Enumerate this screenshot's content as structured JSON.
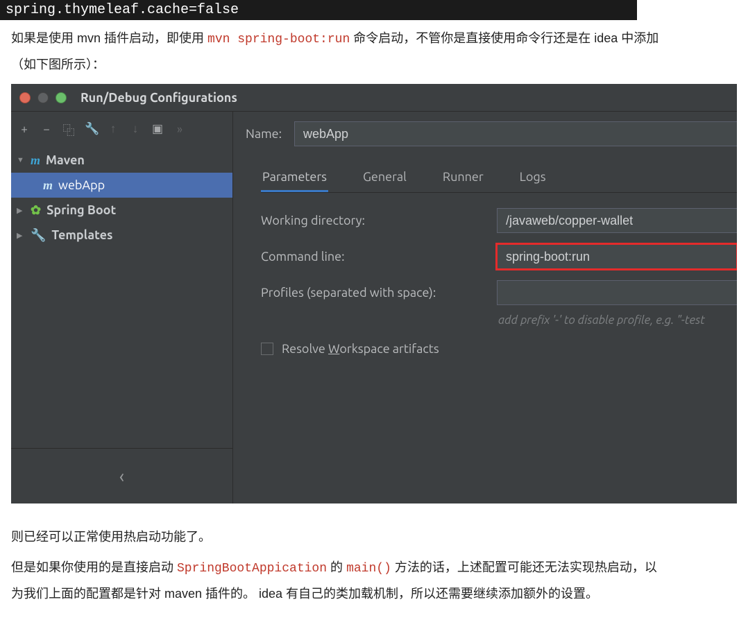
{
  "banner": "spring.thymeleaf.cache=false",
  "para1_a": "如果是使用 mvn 插件启动，即使用 ",
  "para1_code": "mvn spring-boot:run",
  "para1_b": " 命令启动，不管你是直接使用命令行还是在 idea 中添加（如下图所示）：",
  "ide": {
    "title": "Run/Debug Configurations",
    "toolbar": {
      "add": "+",
      "remove": "−",
      "copy": "⿻",
      "wrench": "🔧",
      "up": "↑",
      "down": "↓",
      "folder": "▣",
      "more": "»"
    },
    "tree": {
      "maven": {
        "label": "Maven",
        "child": "webApp"
      },
      "springboot": "Spring Boot",
      "templates": "Templates"
    },
    "nameLabel": "Name:",
    "nameValue": "webApp",
    "tabs": {
      "parameters": "Parameters",
      "general": "General",
      "runner": "Runner",
      "logs": "Logs"
    },
    "form": {
      "wdLabel": "Working directory:",
      "wdValue": "/javaweb/copper-wallet",
      "clLabel": "Command line:",
      "clValue": "spring-boot:run",
      "profLabel": "Profiles (separated with space):",
      "profValue": "",
      "profHint": "add prefix '-' to disable profile, e.g. \"-test",
      "resolveLabel_a": "Resolve ",
      "resolveLabel_u": "W",
      "resolveLabel_b": "orkspace artifacts"
    }
  },
  "para2": "则已经可以正常使用热启动功能了。",
  "para3_a": "但是如果你使用的是直接启动 ",
  "para3_code1": "SpringBootAppication",
  "para3_b": " 的 ",
  "para3_code2": "main()",
  "para3_c": " 方法的话，上述配置可能还无法实现热启动，以为我们上面的配置都是针对 maven 插件的。 idea 有自己的类加载机制，所以还需要继续添加额外的设置。"
}
